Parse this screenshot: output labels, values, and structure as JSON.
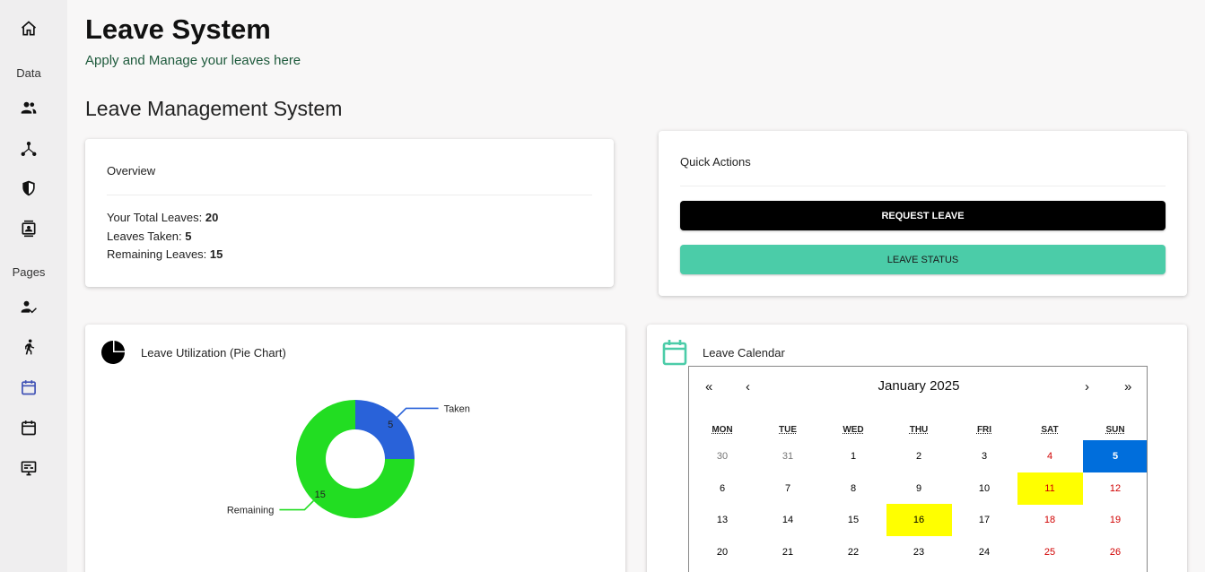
{
  "sidebar": {
    "items": [
      {
        "name": "home-icon"
      },
      {
        "section": "Data"
      },
      {
        "name": "team-icon"
      },
      {
        "name": "hierarchy-icon"
      },
      {
        "name": "shield-icon"
      },
      {
        "name": "contacts-icon"
      },
      {
        "section": "Pages"
      },
      {
        "name": "user-check-icon"
      },
      {
        "name": "running-person-icon"
      },
      {
        "name": "calendar-icon",
        "active": true
      },
      {
        "name": "calendar-alt-icon"
      },
      {
        "name": "monitor-icon"
      }
    ],
    "data_label": "Data",
    "pages_label": "Pages",
    "active_color": "#3f51b5"
  },
  "header": {
    "title": "Leave System",
    "subtitle": "Apply and Manage your leaves here"
  },
  "section": {
    "title": "Leave Management System"
  },
  "overview": {
    "title": "Overview",
    "total_label": "Your Total Leaves: ",
    "total_value": "20",
    "taken_label": "Leaves Taken: ",
    "taken_value": "5",
    "remaining_label": "Remaining Leaves: ",
    "remaining_value": "15"
  },
  "quick_actions": {
    "title": "Quick Actions",
    "request_label": "REQUEST LEAVE",
    "status_label": "LEAVE STATUS"
  },
  "pie": {
    "title": "Leave Utilization (Pie Chart)"
  },
  "chart_data": {
    "type": "pie",
    "title": "Leave Utilization (Pie Chart)",
    "series": [
      {
        "name": "Taken",
        "value": 5,
        "color": "#2962d9"
      },
      {
        "name": "Remaining",
        "value": 15,
        "color": "#22dd22"
      }
    ]
  },
  "calendar": {
    "title": "Leave Calendar",
    "month_label": "January 2025",
    "nav_prev_year": "«",
    "nav_prev": "‹",
    "nav_next": "›",
    "nav_next_year": "»",
    "weekdays": [
      "MON",
      "TUE",
      "WED",
      "THU",
      "FRI",
      "SAT",
      "SUN"
    ],
    "weeks": [
      [
        "30",
        "31",
        "1",
        "2",
        "3",
        "4",
        "5"
      ],
      [
        "6",
        "7",
        "8",
        "9",
        "10",
        "11",
        "12"
      ],
      [
        "13",
        "14",
        "15",
        "16",
        "17",
        "18",
        "19"
      ],
      [
        "20",
        "21",
        "22",
        "23",
        "24",
        "25",
        "26"
      ]
    ],
    "leave_days": [
      "11",
      "16"
    ],
    "today": "5",
    "colors": {
      "weekend": "#d10000",
      "neighbor": "#757575",
      "leave_bg": "#ffff00",
      "today_bg": "#006edc",
      "accent_icon": "#4bcca8"
    }
  }
}
